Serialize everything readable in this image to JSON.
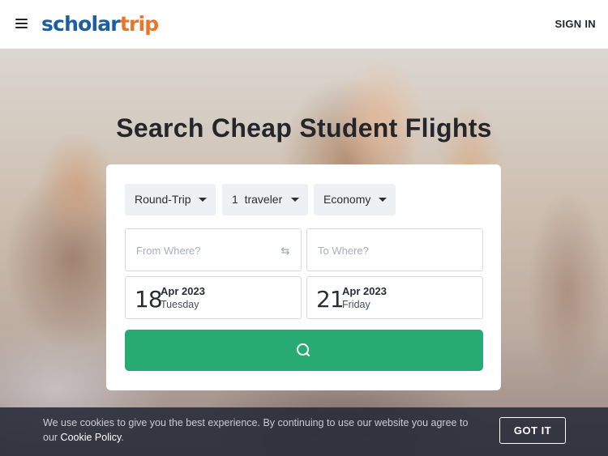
{
  "header": {
    "logo_part1": "scholar",
    "logo_part2": "trip",
    "signin_label": "SIGN IN"
  },
  "hero": {
    "title": "Search Cheap Student Flights"
  },
  "search": {
    "trip_type": "Round-Trip",
    "travelers": "1  traveler",
    "cabin_class": "Economy",
    "from_placeholder": "From Where?",
    "to_placeholder": "To Where?",
    "depart": {
      "day": "18",
      "month_year": "Apr 2023",
      "weekday": "Tuesday"
    },
    "return": {
      "day": "21",
      "month_year": "Apr 2023",
      "weekday": "Friday"
    }
  },
  "cookie": {
    "text": "We use cookies to give you the best experience. By continuing to use our website you agree to our ",
    "link": "Cookie Policy",
    "after_link": ".",
    "button": "GOT IT"
  },
  "colors": {
    "brand_blue": "#1c5ea6",
    "brand_orange": "#e8752b",
    "search_green": "#28aa73",
    "cookie_bg": "#262a38"
  },
  "icons": {
    "menu": "hamburger-menu-icon",
    "swap": "swap-arrows-icon",
    "search": "search-magnifier-icon",
    "dropdown": "caret-down-icon"
  }
}
